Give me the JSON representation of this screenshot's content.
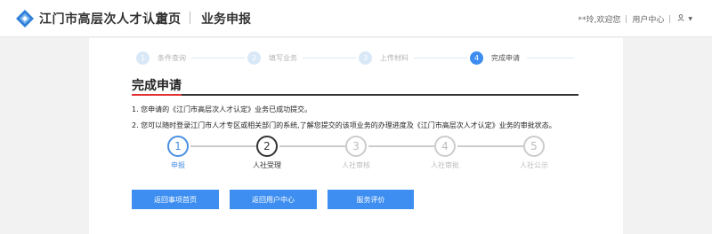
{
  "header": {
    "brand": "江门市高层次人才认定",
    "nav": [
      "首页",
      "业务申报"
    ],
    "greeting": "**玲,欢迎您",
    "user_center": "用户中心",
    "person_icon": "person-icon",
    "caret_icon": "caret-down-icon"
  },
  "top_steps": [
    {
      "num": "1",
      "label": "条件查询",
      "active": false
    },
    {
      "num": "2",
      "label": "填写业务",
      "active": false
    },
    {
      "num": "3",
      "label": "上传材料",
      "active": false
    },
    {
      "num": "4",
      "label": "完成申请",
      "active": true
    }
  ],
  "section_title": "完成申请",
  "messages": {
    "line1": "1. 您申请的《江门市高层次人才认定》业务已成功提交。",
    "line2": "2. 您可以随时登录江门市人才专区或相关部门的系统,了解您提交的该项业务的办理进度及《江门市高层次人才认定》业务的审批状态。"
  },
  "progress": [
    {
      "num": "1",
      "label": "申报",
      "state": "done"
    },
    {
      "num": "2",
      "label": "人社受理",
      "state": "current"
    },
    {
      "num": "3",
      "label": "人社审核",
      "state": "pending"
    },
    {
      "num": "4",
      "label": "人社审批",
      "state": "pending"
    },
    {
      "num": "5",
      "label": "人社公示",
      "state": "pending"
    }
  ],
  "buttons": {
    "back_home": "返回事项首页",
    "back_user": "返回用户中心",
    "evaluate": "服务评价"
  },
  "colors": {
    "accent": "#3d8ef0",
    "title_red": "#e0302f"
  }
}
